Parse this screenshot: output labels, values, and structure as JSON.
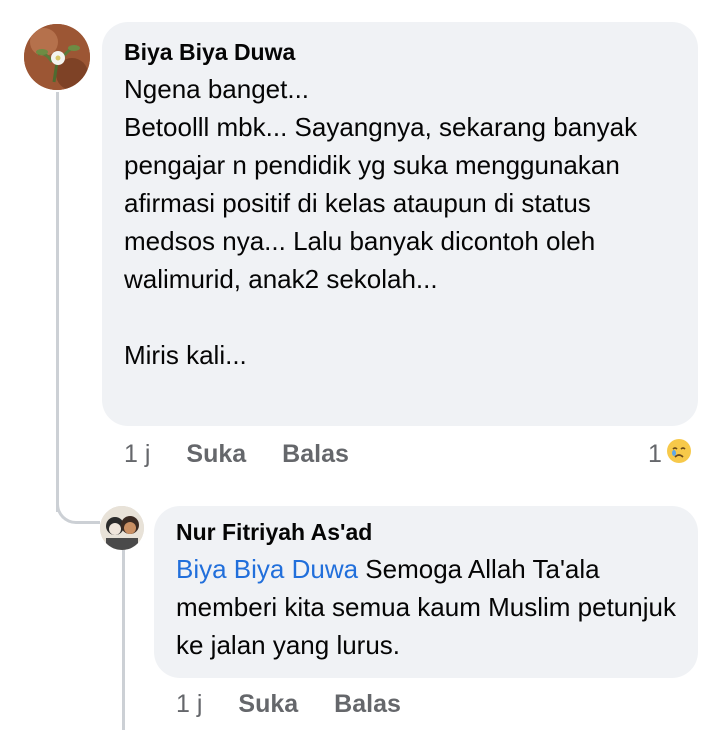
{
  "comment1": {
    "author": "Biya Biya Duwa",
    "text": "Ngena banget...\nBetoolll mbk... Sayangnya, sekarang banyak pengajar n pendidik yg suka menggunakan afirmasi positif di kelas ataupun di status medsos nya... Lalu banyak dicontoh oleh walimurid, anak2 sekolah...\n\nMiris kali...",
    "time": "1 j",
    "like_label": "Suka",
    "reply_label": "Balas",
    "reaction_count": "1",
    "reaction_icon": "sad-cry-face-icon"
  },
  "reply1": {
    "author": "Nur Fitriyah As'ad",
    "mention": "Biya Biya Duwa",
    "text": " Semoga Allah Ta'ala memberi kita semua kaum Muslim petunjuk ke jalan yang lurus.",
    "time": "1 j",
    "like_label": "Suka",
    "reply_label": "Balas"
  },
  "colors": {
    "bubble": "#f0f2f5",
    "mention": "#216fdb",
    "meta": "#65676b",
    "thread_line": "#ccd0d5"
  }
}
